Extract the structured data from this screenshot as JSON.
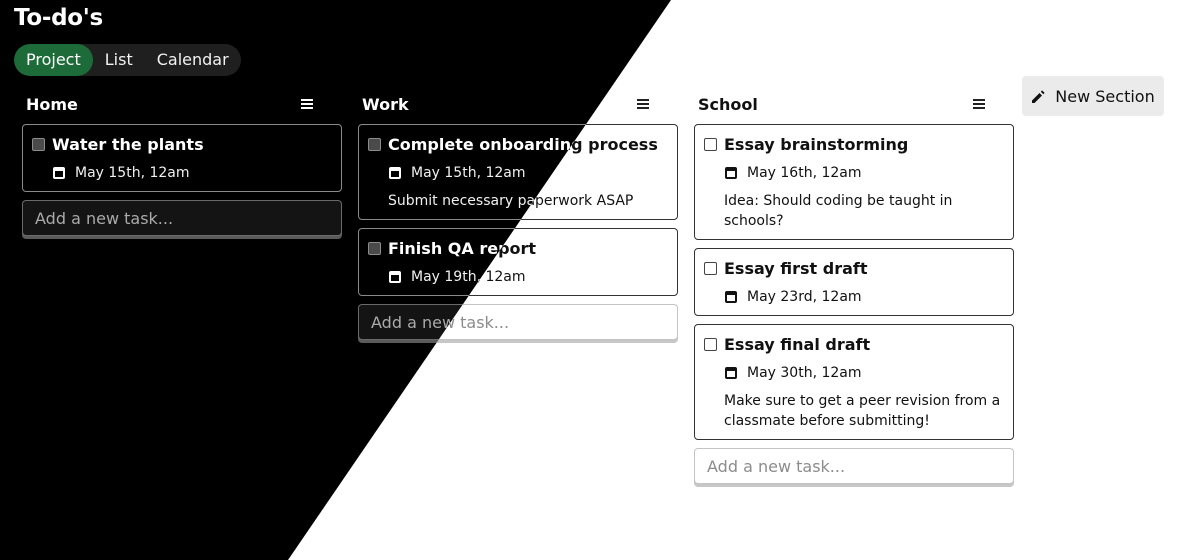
{
  "app": {
    "title": "To-do's"
  },
  "view_tabs": [
    {
      "label": "Project",
      "active": true
    },
    {
      "label": "List",
      "active": false
    },
    {
      "label": "Calendar",
      "active": false
    }
  ],
  "new_section_label": "New Section",
  "add_task_placeholder": "Add a new task...",
  "sections": [
    {
      "title": "Home",
      "tasks": [
        {
          "title": "Water the plants",
          "date": "May 15th, 12am",
          "description": ""
        }
      ]
    },
    {
      "title": "Work",
      "tasks": [
        {
          "title": "Complete onboarding process",
          "date": "May 15th, 12am",
          "description": "Submit necessary paperwork ASAP"
        },
        {
          "title": "Finish QA report",
          "date": "May 19th, 12am",
          "description": ""
        }
      ]
    },
    {
      "title": "School",
      "tasks": [
        {
          "title": "Essay brainstorming",
          "date": "May 16th, 12am",
          "description": "Idea: Should coding be taught in schools?"
        },
        {
          "title": "Essay first draft",
          "date": "May 23rd, 12am",
          "description": ""
        },
        {
          "title": "Essay final draft",
          "date": "May 30th, 12am",
          "description": "Make sure to get a peer revision from a classmate before submitting!"
        }
      ]
    }
  ],
  "colors": {
    "active_tab": "#1e6b3a",
    "dark_background": "#000000",
    "light_background": "#ffffff"
  }
}
